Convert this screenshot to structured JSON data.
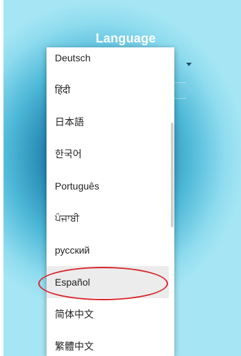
{
  "header": {
    "title": "Language"
  },
  "menu": {
    "items": [
      {
        "label": "Deutsch"
      },
      {
        "label": "हिंदी"
      },
      {
        "label": "日本語"
      },
      {
        "label": "한국어"
      },
      {
        "label": "Português"
      },
      {
        "label": "ਪੰਜਾਬੀ"
      },
      {
        "label": "русский"
      },
      {
        "label": "Español"
      },
      {
        "label": "简体中文"
      },
      {
        "label": "繁體中文"
      }
    ],
    "selected_label": "Español"
  },
  "annotation": {
    "color": "#d9262e"
  }
}
